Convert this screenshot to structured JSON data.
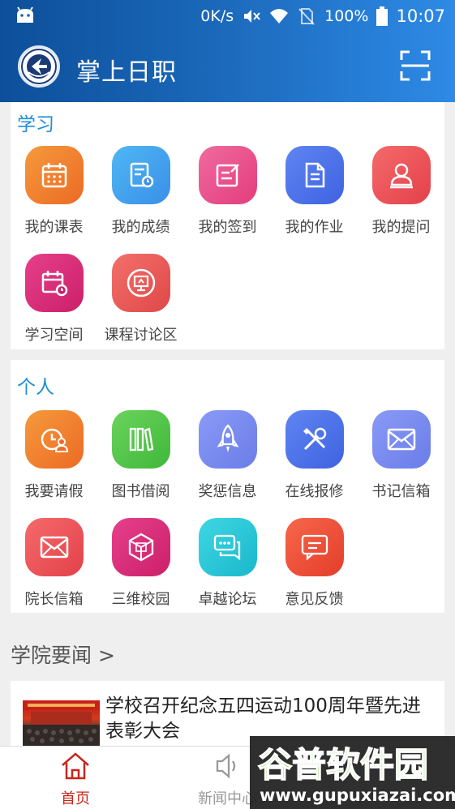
{
  "status_bar": {
    "net_speed": "0K/s",
    "battery": "100%",
    "time": "10:07"
  },
  "app_bar": {
    "title": "掌上日职",
    "logo_icon": "college-emblem-icon",
    "scan_icon": "scan-icon"
  },
  "study": {
    "title": "学习",
    "items": [
      {
        "label": "我的课表",
        "icon": "calendar-icon"
      },
      {
        "label": "我的成绩",
        "icon": "report-clock-icon"
      },
      {
        "label": "我的签到",
        "icon": "sign-in-icon"
      },
      {
        "label": "我的作业",
        "icon": "homework-icon"
      },
      {
        "label": "我的提问",
        "icon": "user-question-icon"
      },
      {
        "label": "学习空间",
        "icon": "calendar-clock-icon"
      },
      {
        "label": "课程讨论区",
        "icon": "presentation-icon"
      }
    ]
  },
  "personal": {
    "title": "个人",
    "items": [
      {
        "label": "我要请假",
        "icon": "leave-request-icon"
      },
      {
        "label": "图书借阅",
        "icon": "books-icon"
      },
      {
        "label": "奖惩信息",
        "icon": "rocket-icon"
      },
      {
        "label": "在线报修",
        "icon": "tools-icon"
      },
      {
        "label": "书记信箱",
        "icon": "mail-icon"
      },
      {
        "label": "院长信箱",
        "icon": "mail-icon"
      },
      {
        "label": "三维校园",
        "icon": "cube-icon"
      },
      {
        "label": "卓越论坛",
        "icon": "chat-icon"
      },
      {
        "label": "意见反馈",
        "icon": "feedback-icon"
      }
    ]
  },
  "news": {
    "section_title": "学院要闻 >",
    "items": [
      {
        "title": "学校召开纪念五四运动100周年暨先进表彰大会"
      }
    ]
  },
  "bottom_nav": {
    "items": [
      {
        "label": "首页",
        "icon": "home-icon",
        "active": true
      },
      {
        "label": "新闻中心",
        "icon": "speaker-icon",
        "active": false
      }
    ]
  },
  "watermark": {
    "brand": "谷普软件园",
    "url": "www.gupuxiazai.com"
  },
  "colors": {
    "accent": "#1f8ed8",
    "nav_active": "#c7261c",
    "header_start": "#0d4f9a",
    "header_end": "#2e8ae6"
  }
}
